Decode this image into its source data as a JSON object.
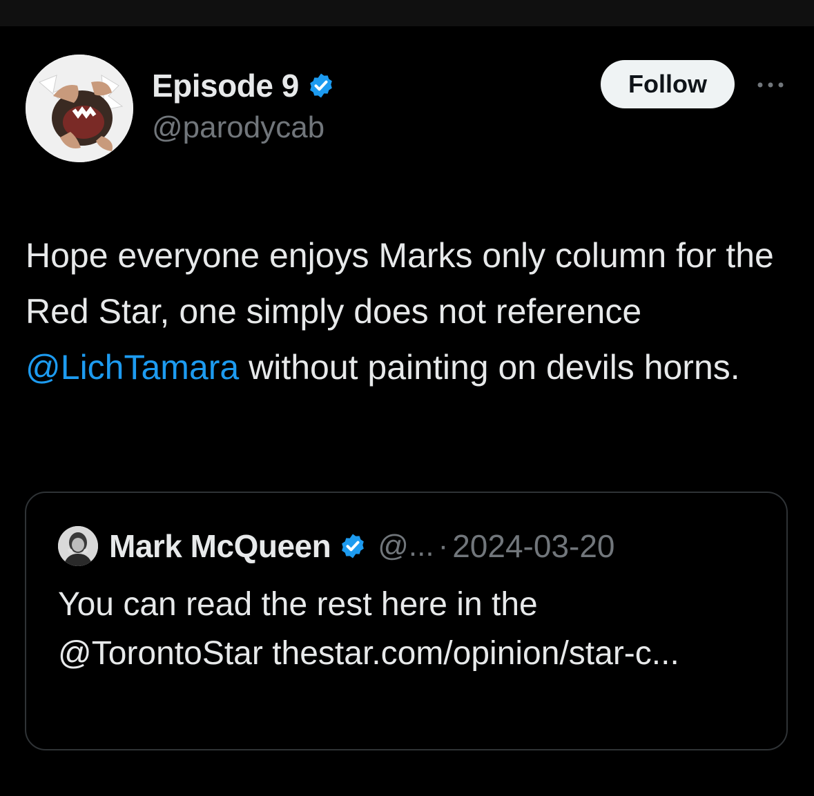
{
  "author": {
    "display_name": "Episode 9",
    "handle": "@parodycab",
    "verified_icon": "verified-badge-icon"
  },
  "actions": {
    "follow_label": "Follow",
    "more_icon": "more-horizontal-icon"
  },
  "tweet": {
    "text_before": "Hope everyone enjoys Marks only column for the Red Star, one simply does not reference ",
    "mention": "@LichTamara",
    "text_after": " without painting on devils horns."
  },
  "quoted_tweet": {
    "display_name": "Mark McQueen",
    "handle": "@...",
    "separator": "·",
    "date": "2024-03-20",
    "text": "You can read the rest here in the @TorontoStar thestar.com/opinion/star-c..."
  },
  "colors": {
    "background": "#000000",
    "text": "#e7e9ea",
    "secondary_text": "#71767b",
    "accent": "#1d9bf0",
    "border": "#2f3336"
  }
}
